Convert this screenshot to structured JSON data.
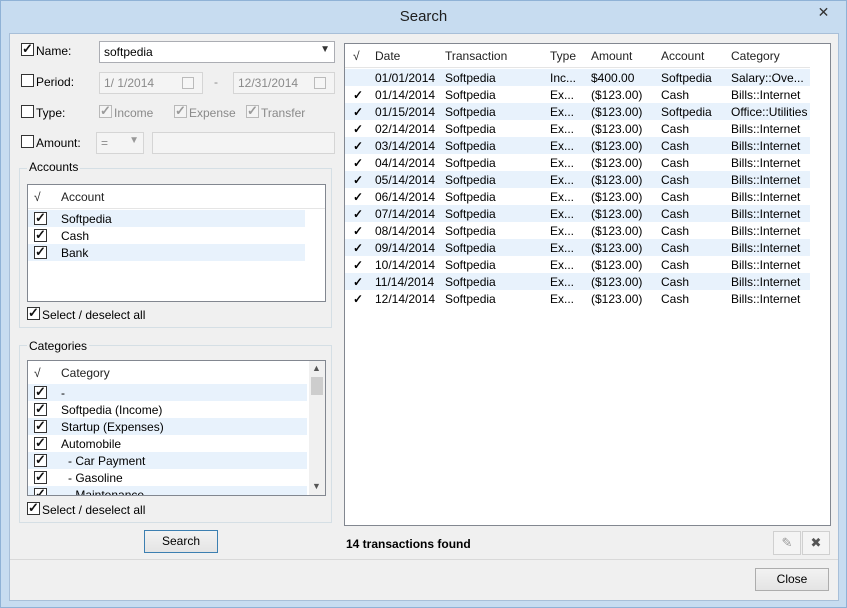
{
  "window": {
    "title": "Search",
    "close_glyph": "✕"
  },
  "filters": {
    "name": {
      "label": "Name:",
      "checked": true,
      "value": "softpedia"
    },
    "period": {
      "label": "Period:",
      "checked": false,
      "from": "1/ 1/2014",
      "to": "12/31/2014",
      "separator": "-"
    },
    "type": {
      "label": "Type:",
      "checked": false,
      "options": [
        {
          "label": "Income",
          "checked": true
        },
        {
          "label": "Expense",
          "checked": true
        },
        {
          "label": "Transfer",
          "checked": true
        }
      ]
    },
    "amount": {
      "label": "Amount:",
      "checked": false,
      "operator": "="
    }
  },
  "accounts": {
    "title": "Accounts",
    "col_check": "√",
    "col_name": "Account",
    "items": [
      "Softpedia",
      "Cash",
      "Bank"
    ],
    "select_all": "Select / deselect all"
  },
  "categories": {
    "title": "Categories",
    "col_check": "√",
    "col_name": "Category",
    "items": [
      "-",
      "Softpedia (Income)",
      "Startup (Expenses)",
      "Automobile",
      "- Car Payment",
      "- Gasoline",
      "- Maintenance"
    ],
    "select_all": "Select / deselect all"
  },
  "search_button": "Search",
  "results": {
    "columns": [
      "√",
      "Date",
      "Transaction",
      "Type",
      "Amount",
      "Account",
      "Category"
    ],
    "rows": [
      [
        "01/01/2014",
        "Softpedia",
        "Inc...",
        "$400.00",
        "Softpedia",
        "Salary::Ove..."
      ],
      [
        "01/14/2014",
        "Softpedia",
        "Ex...",
        "($123.00)",
        "Cash",
        "Bills::Internet"
      ],
      [
        "01/15/2014",
        "Softpedia",
        "Ex...",
        "($123.00)",
        "Softpedia",
        "Office::Utilities"
      ],
      [
        "02/14/2014",
        "Softpedia",
        "Ex...",
        "($123.00)",
        "Cash",
        "Bills::Internet"
      ],
      [
        "03/14/2014",
        "Softpedia",
        "Ex...",
        "($123.00)",
        "Cash",
        "Bills::Internet"
      ],
      [
        "04/14/2014",
        "Softpedia",
        "Ex...",
        "($123.00)",
        "Cash",
        "Bills::Internet"
      ],
      [
        "05/14/2014",
        "Softpedia",
        "Ex...",
        "($123.00)",
        "Cash",
        "Bills::Internet"
      ],
      [
        "06/14/2014",
        "Softpedia",
        "Ex...",
        "($123.00)",
        "Cash",
        "Bills::Internet"
      ],
      [
        "07/14/2014",
        "Softpedia",
        "Ex...",
        "($123.00)",
        "Cash",
        "Bills::Internet"
      ],
      [
        "08/14/2014",
        "Softpedia",
        "Ex...",
        "($123.00)",
        "Cash",
        "Bills::Internet"
      ],
      [
        "09/14/2014",
        "Softpedia",
        "Ex...",
        "($123.00)",
        "Cash",
        "Bills::Internet"
      ],
      [
        "10/14/2014",
        "Softpedia",
        "Ex...",
        "($123.00)",
        "Cash",
        "Bills::Internet"
      ],
      [
        "11/14/2014",
        "Softpedia",
        "Ex...",
        "($123.00)",
        "Cash",
        "Bills::Internet"
      ],
      [
        "12/14/2014",
        "Softpedia",
        "Ex...",
        "($123.00)",
        "Cash",
        "Bills::Internet"
      ]
    ],
    "row_checked": [
      false,
      true,
      true,
      true,
      true,
      true,
      true,
      true,
      true,
      true,
      true,
      true,
      true,
      true
    ],
    "status": "14 transactions found"
  },
  "icons": {
    "edit": "pencil-icon",
    "delete": "delete-icon"
  },
  "close_button": "Close"
}
